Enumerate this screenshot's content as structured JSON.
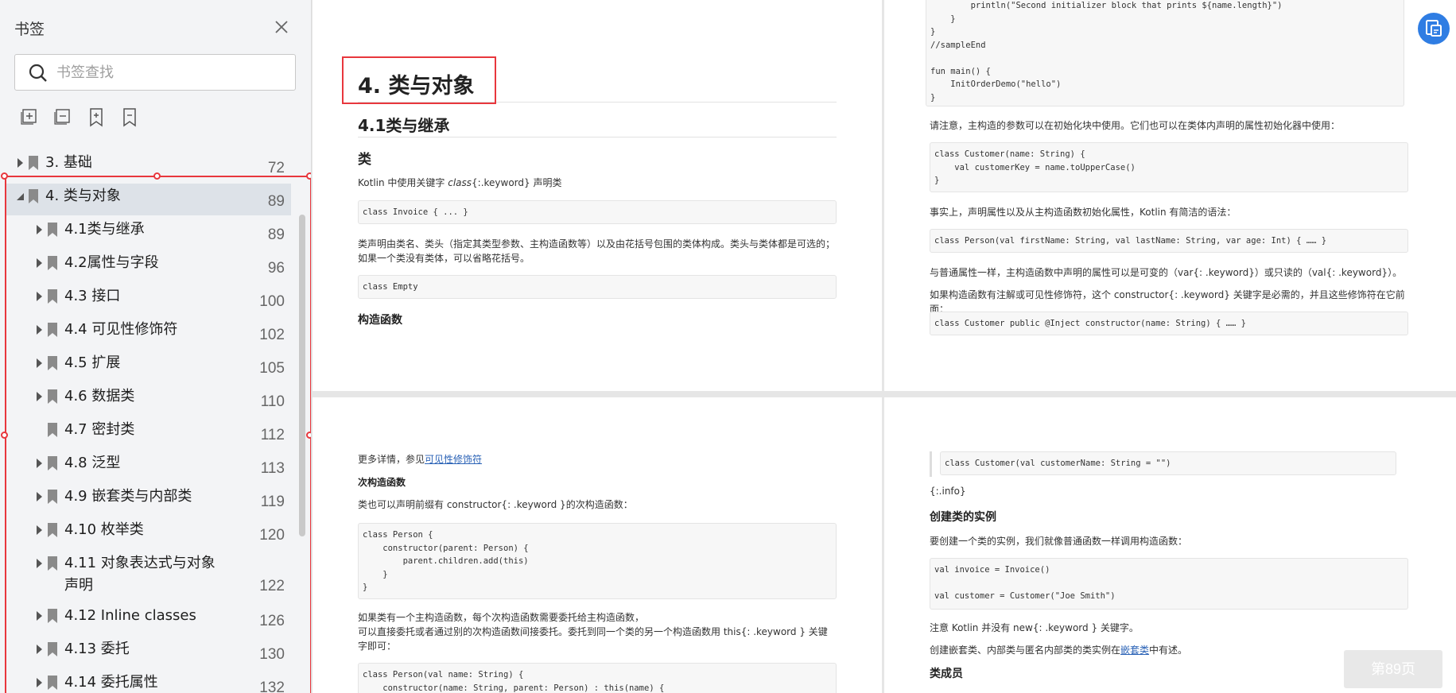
{
  "sidebar": {
    "title": "书签",
    "search_placeholder": "书签查找",
    "items": [
      {
        "label": "3. 基础",
        "page": "72",
        "expanded": false
      },
      {
        "label": "4. 类与对象",
        "page": "89",
        "expanded": true
      },
      {
        "label": "4.1类与继承",
        "page": "89"
      },
      {
        "label": "4.2属性与字段",
        "page": "96"
      },
      {
        "label": "4.3 接口",
        "page": "100"
      },
      {
        "label": "4.4 可见性修饰符",
        "page": "102"
      },
      {
        "label": "4.5 扩展",
        "page": "105"
      },
      {
        "label": "4.6 数据类",
        "page": "110"
      },
      {
        "label": "4.7 密封类",
        "page": "112"
      },
      {
        "label": "4.8 泛型",
        "page": "113"
      },
      {
        "label": "4.9 嵌套类与内部类",
        "page": "119"
      },
      {
        "label": "4.10 枚举类",
        "page": "120"
      },
      {
        "label": "4.11 对象表达式与对象声明",
        "page": "122"
      },
      {
        "label": "4.12 Inline classes",
        "page": "126"
      },
      {
        "label": "4.13 委托",
        "page": "130"
      },
      {
        "label": "4.14 委托属性",
        "page": "132"
      }
    ]
  },
  "page1": {
    "h1": "4. 类与对象",
    "h2": "4.1类与继承",
    "h3_class": "类",
    "p1_a": "Kotlin 中使用关键字 ",
    "p1_b": "class",
    "p1_c": "{:.keyword} 声明类",
    "code1": "class Invoice { ... }",
    "p2": "类声明由类名、类头（指定其类型参数、主构造函数等）以及由花括号包围的类体构成。类头与类体都是可选的；如果一个类没有类体，可以省略花括号。",
    "code2": "class Empty",
    "h4_ctor": "构造函数"
  },
  "page2": {
    "code_top": "        println(\"Second initializer block that prints ${name.length}\")\n    }\n}\n//sampleEnd\n\nfun main() {\n    InitOrderDemo(\"hello\")\n}",
    "p1": "请注意，主构造的参数可以在初始化块中使用。它们也可以在类体内声明的属性初始化器中使用：",
    "code1": "class Customer(name: String) {\n    val customerKey = name.toUpperCase()\n}",
    "p2": "事实上，声明属性以及从主构造函数初始化属性，Kotlin 有简洁的语法：",
    "code2": "class Person(val firstName: String, val lastName: String, var age: Int) { …… }",
    "p3": "与普通属性一样，主构造函数中声明的属性可以是可变的（var{: .keyword}）或只读的（val{: .keyword}）。",
    "p4": "如果构造函数有注解或可见性修饰符，这个 constructor{: .keyword} 关键字是必需的，并且这些修饰符在它前面：",
    "code3": "class Customer public @Inject constructor(name: String) { …… }"
  },
  "page3": {
    "p1_a": "更多详情，参见",
    "p1_link": "可见性修饰符",
    "h4_secondary": "次构造函数",
    "p2": "类也可以声明前缀有 constructor{: .keyword }的次构造函数：",
    "code1": "class Person {\n    constructor(parent: Person) {\n        parent.children.add(this)\n    }\n}",
    "p3": "如果类有一个主构造函数，每个次构造函数需要委托给主构造函数，\n可以直接委托或者通过别的次构造函数间接委托。委托到同一个类的另一个构造函数用 this{: .keyword } 关键字即可：",
    "code2": "class Person(val name: String) {\n    constructor(name: String, parent: Person) : this(name) {"
  },
  "page4": {
    "code1": "class Customer(val customerName: String = \"\")",
    "p_info": "{:.info}",
    "h3_instances": "创建类的实例",
    "p1": "要创建一个类的实例，我们就像普通函数一样调用构造函数：",
    "code2": "val invoice = Invoice()\n\nval customer = Customer(\"Joe Smith\")",
    "p2": "注意 Kotlin 并没有 new{: .keyword } 关键字。",
    "p3_a": "创建嵌套类、内部类与匿名内部类的类实例在",
    "p3_link": "嵌套类",
    "p3_b": "中有述。",
    "h4_members": "类成员"
  },
  "page_indicator": "第89页"
}
